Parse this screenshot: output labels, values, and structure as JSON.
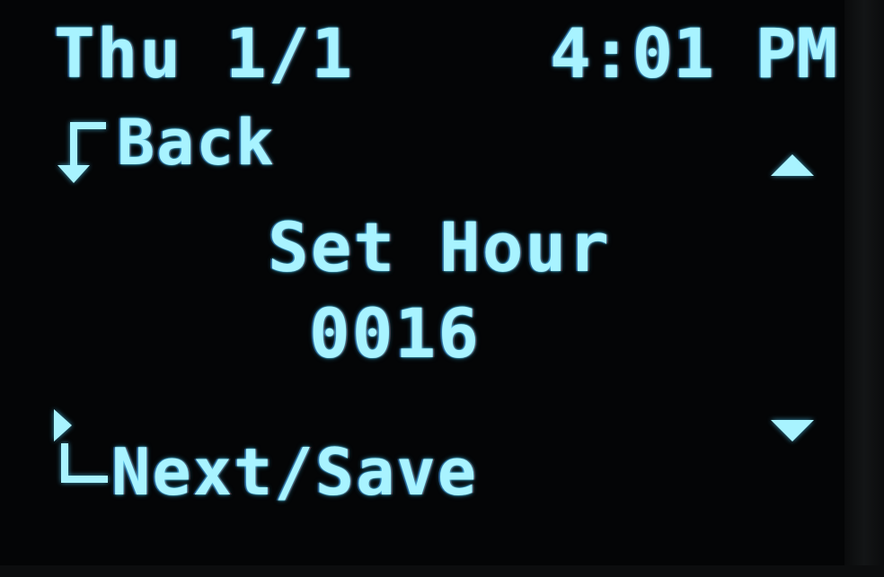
{
  "status_bar": {
    "date": "Thu 1/1",
    "time": "4:01 PM"
  },
  "nav": {
    "back_label": "Back",
    "next_label": "Next/Save",
    "back_icon": "return-arrow-icon",
    "next_icon": "enter-arrow-icon",
    "up_icon": "triangle-up-icon",
    "down_icon": "triangle-down-icon"
  },
  "setting": {
    "title": "Set Hour",
    "value": "0016"
  },
  "colors": {
    "text": "#a8f3ff",
    "glow": "#4fd8ff",
    "background": "#040506"
  }
}
